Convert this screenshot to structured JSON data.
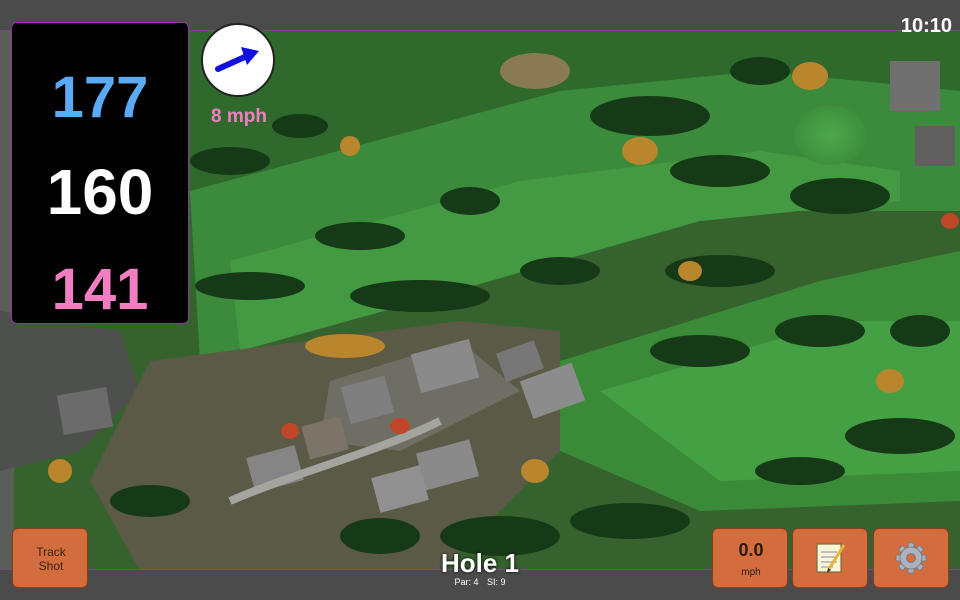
{
  "status": {
    "clock": "10:10"
  },
  "distances": {
    "back": "177",
    "middle": "160",
    "front": "141"
  },
  "wind": {
    "speed_label": "8 mph",
    "direction_icon": "wind-direction-arrow-icon"
  },
  "hole": {
    "title": "Hole 1",
    "par_label": "Par: 4",
    "si_label": "SI: 9"
  },
  "buttons": {
    "track_shot": {
      "line1": "Track",
      "line2": "Shot"
    },
    "wind_speed": {
      "value": "0.0",
      "unit": "mph"
    },
    "notes": {
      "icon": "notepad-icon"
    },
    "settings": {
      "icon": "gear-icon"
    }
  },
  "colors": {
    "back_distance": "#5aaaf5",
    "middle_distance": "#ffffff",
    "front_distance": "#f27ec2",
    "wind_label": "#f27ec2",
    "button": "#d46d3d",
    "panel_border": "#8e3aa0",
    "wind_arrow": "#1010e0"
  }
}
